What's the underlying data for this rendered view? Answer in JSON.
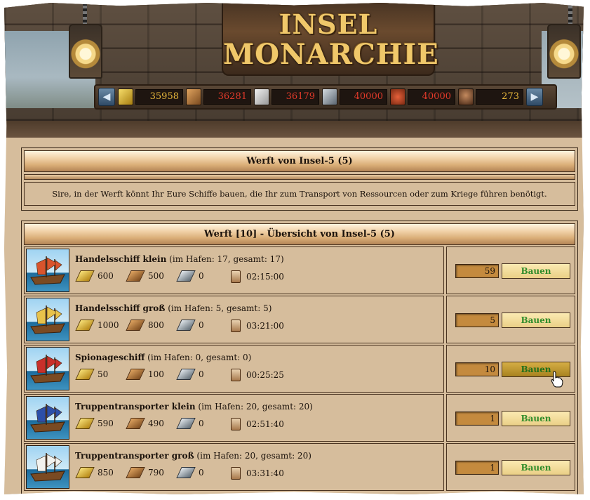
{
  "header": {
    "logo_line1": "INSEL",
    "logo_line2": "MONARCHIE"
  },
  "resources": [
    {
      "icon": "gold-icon",
      "value": "35958",
      "color": "#e8b83c"
    },
    {
      "icon": "wood-icon",
      "value": "36281",
      "color": "#e23a2a"
    },
    {
      "icon": "stone-icon",
      "value": "36179",
      "color": "#e23a2a"
    },
    {
      "icon": "iron-icon",
      "value": "40000",
      "color": "#e23a2a"
    },
    {
      "icon": "food-icon",
      "value": "40000",
      "color": "#e23a2a"
    },
    {
      "icon": "population-icon",
      "value": "273",
      "color": "#e8b83c"
    }
  ],
  "shipyard": {
    "title": "Werft von Insel-5 (5)",
    "description": "Sire, in der Werft könnt Ihr Eure Schiffe bauen, die Ihr zum Transport von Ressourcen oder zum Kriege führen benötigt."
  },
  "overview": {
    "title": "Werft [10] - Übersicht von Insel-5 (5)",
    "build_label": "Bauen",
    "ships": [
      {
        "name": "Handelsschiff klein",
        "harbor": "(im Hafen: 17, gesamt: 17)",
        "gold": "600",
        "wood": "500",
        "iron": "0",
        "time": "02:15:00",
        "qty": "59",
        "sail_color": "#d9542c"
      },
      {
        "name": "Handelsschiff groß",
        "harbor": "(im Hafen: 5, gesamt: 5)",
        "gold": "1000",
        "wood": "800",
        "iron": "0",
        "time": "03:21:00",
        "qty": "5",
        "sail_color": "#e8c24a"
      },
      {
        "name": "Spionageschiff",
        "harbor": "(im Hafen: 0, gesamt: 0)",
        "gold": "50",
        "wood": "100",
        "iron": "0",
        "time": "00:25:25",
        "qty": "10",
        "sail_color": "#c8302a"
      },
      {
        "name": "Truppentransporter klein",
        "harbor": "(im Hafen: 20, gesamt: 20)",
        "gold": "590",
        "wood": "490",
        "iron": "0",
        "time": "02:51:40",
        "qty": "1",
        "sail_color": "#2d4fa8"
      },
      {
        "name": "Truppentransporter groß",
        "harbor": "(im Hafen: 20, gesamt: 20)",
        "gold": "850",
        "wood": "790",
        "iron": "0",
        "time": "03:31:40",
        "qty": "1",
        "sail_color": "#f2f2ee"
      }
    ]
  }
}
